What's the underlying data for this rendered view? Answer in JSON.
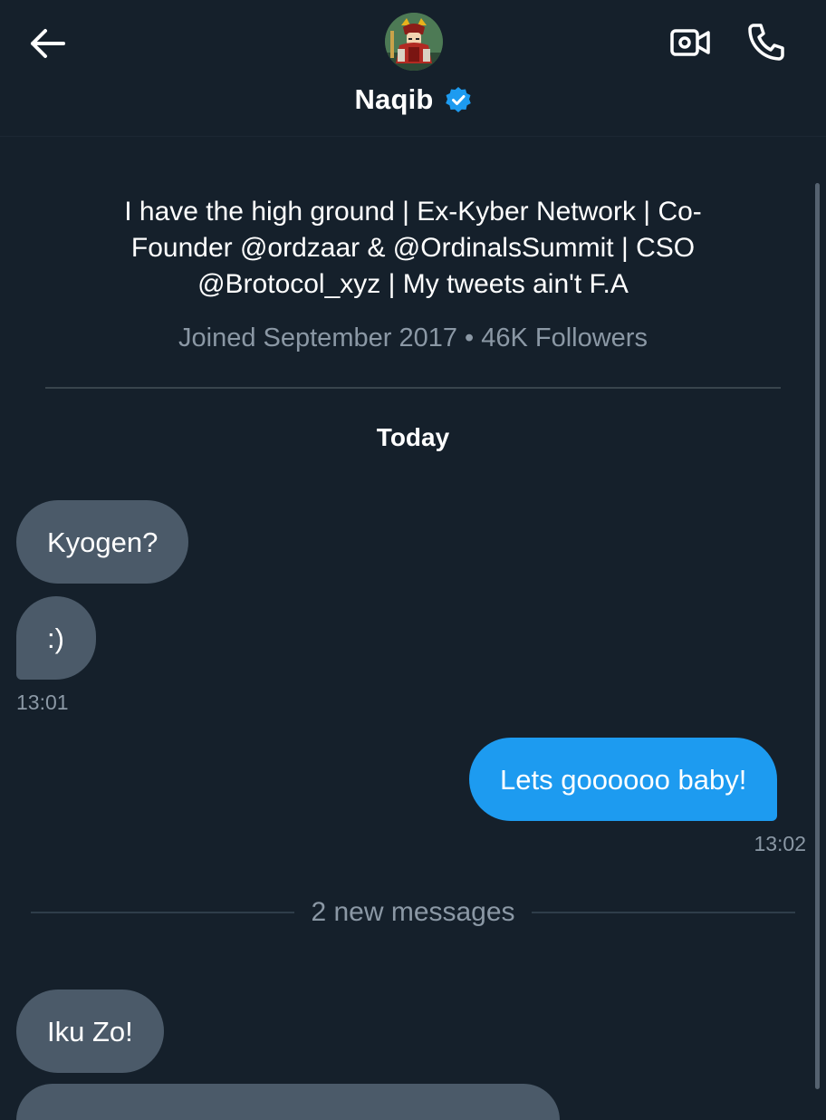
{
  "header": {
    "title": "Naqib",
    "verified": true,
    "back_icon": "arrow-left-icon",
    "video_icon": "video-camera-icon",
    "phone_icon": "phone-icon"
  },
  "profile": {
    "bio_lines": [
      "I have the high ground | Ex-Kyber Network | Co-",
      "Founder @ordzaar & @OrdinalsSummit | CSO",
      "@Brotocol_xyz | My tweets ain't F.A"
    ],
    "meta": "Joined September 2017 • 46K Followers"
  },
  "conversation": {
    "date_label": "Today",
    "messages": [
      {
        "text": "Kyogen?",
        "side": "incoming"
      },
      {
        "text": ":)",
        "side": "incoming",
        "time": "13:01"
      },
      {
        "text": "Lets goooooo baby!",
        "side": "outgoing",
        "time": "13:02"
      },
      {
        "text": "Iku Zo!",
        "side": "incoming"
      }
    ],
    "new_messages_label": "2 new messages"
  },
  "colors": {
    "background": "#15202b",
    "incoming_bubble": "#4b5a69",
    "outgoing_bubble": "#1d9bf0",
    "verified_badge": "#1d9bf0",
    "muted_text": "#8b98a5"
  }
}
